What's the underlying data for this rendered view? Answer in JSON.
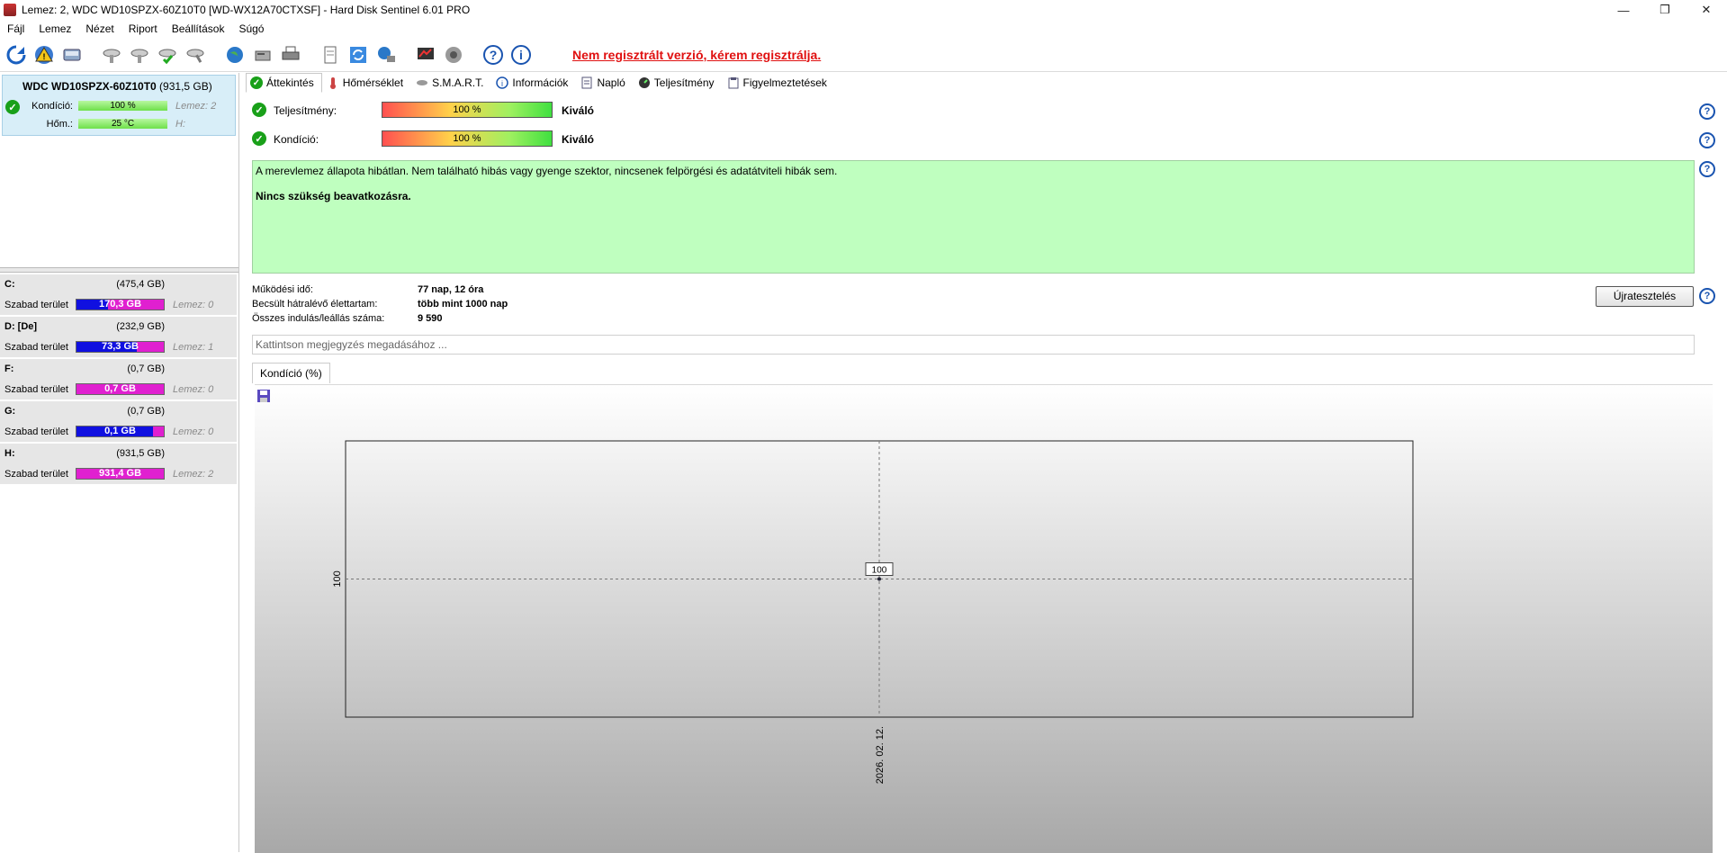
{
  "window": {
    "title": "Lemez: 2, WDC WD10SPZX-60Z10T0 [WD-WX12A70CTXSF]  -  Hard Disk Sentinel 6.01 PRO",
    "minimize": "—",
    "maximize": "❐",
    "close": "✕"
  },
  "menu": [
    "Fájl",
    "Lemez",
    "Nézet",
    "Riport",
    "Beállítások",
    "Súgó"
  ],
  "toolbar": {
    "unregistered_notice": "Nem regisztrált verzió, kérem regisztrálja.",
    "icons": [
      "refresh-icon",
      "alert-icon",
      "disk-icon",
      "disk-test-icon",
      "disk-test2-icon",
      "disk-ok-icon",
      "disk-tool-icon",
      "globe-icon",
      "server-icon",
      "print-icon",
      "report-icon",
      "sync-icon",
      "network-icon",
      "monitor-icon",
      "settings-icon",
      "help-icon",
      "info-icon"
    ]
  },
  "disk": {
    "name": "WDC WD10SPZX-60Z10T0",
    "size": "(931,5 GB)",
    "condition_label": "Kondíció:",
    "condition_value": "100 %",
    "disk_index": "Lemez: 2",
    "temp_label": "Hőm.:",
    "temp_value": "25 °C",
    "drive_letter": "H:"
  },
  "volumes": [
    {
      "name": "C:",
      "size": "(475,4 GB)",
      "free_label": "Szabad terület",
      "free": "170,3 GB",
      "free_fraction": 0.36,
      "disk": "Lemez: 0"
    },
    {
      "name": "D: [De]",
      "size": "(232,9 GB)",
      "free_label": "Szabad terület",
      "free": "73,3 GB",
      "free_fraction": 0.69,
      "disk": "Lemez: 1"
    },
    {
      "name": "F:",
      "size": "(0,7 GB)",
      "free_label": "Szabad terület",
      "free": "0,7 GB",
      "free_fraction": 0.0,
      "disk": "Lemez: 0"
    },
    {
      "name": "G:",
      "size": "(0,7 GB)",
      "free_label": "Szabad terület",
      "free": "0,1 GB",
      "free_fraction": 0.88,
      "disk": "Lemez: 0"
    },
    {
      "name": "H:",
      "size": "(931,5 GB)",
      "free_label": "Szabad terület",
      "free": "931,4 GB",
      "free_fraction": 0.0,
      "disk": "Lemez: 2"
    }
  ],
  "tabs": [
    "Áttekintés",
    "Hőmérséklet",
    "S.M.A.R.T.",
    "Információk",
    "Napló",
    "Teljesítmény",
    "Figyelmeztetések"
  ],
  "overview": {
    "performance_label": "Teljesítmény:",
    "performance_value": "100 %",
    "performance_fraction": 1.0,
    "performance_rating": "Kiváló",
    "health_label": "Kondíció:",
    "health_value": "100 %",
    "health_fraction": 1.0,
    "health_rating": "Kiváló",
    "status_text": "A merevlemez állapota hibátlan. Nem található hibás vagy gyenge szektor, nincsenek felpörgési és adatátviteli hibák sem.",
    "status_action": "Nincs szükség beavatkozásra.",
    "power_on_label": "Működési idő:",
    "power_on_value": "77 nap, 12 óra",
    "lifetime_label": "Becsült hátralévő élettartam:",
    "lifetime_value": "több mint 1000 nap",
    "starts_label": "Összes indulás/leállás száma:",
    "starts_value": "9 590",
    "retest_button": "Újratesztelés",
    "note_placeholder": "Kattintson megjegyzés megadásához ...",
    "chart_tab": "Kondíció  (%)"
  },
  "chart_data": {
    "type": "line",
    "x": [
      "2026. 02. 12."
    ],
    "series": [
      {
        "values": [
          100
        ]
      }
    ],
    "data_labels": [
      "100"
    ],
    "y_ticks": [
      "100"
    ],
    "grid": true
  }
}
